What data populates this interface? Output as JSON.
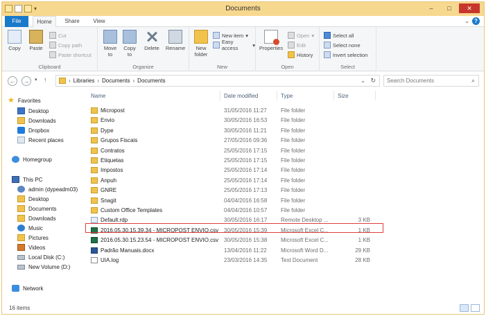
{
  "window": {
    "title": "Documents"
  },
  "ribbon_tabs": [
    "File",
    "Home",
    "Share",
    "View"
  ],
  "ribbon": {
    "clipboard": {
      "copy": "Copy",
      "paste": "Paste",
      "cut": "Cut",
      "copy_path": "Copy path",
      "paste_shortcut": "Paste shortcut",
      "label": "Clipboard"
    },
    "organize": {
      "move_to": "Move to",
      "copy_to": "Copy to",
      "delete": "Delete",
      "rename": "Rename",
      "label": "Organize"
    },
    "new": {
      "new_folder": "New folder",
      "new_item": "New item",
      "easy_access": "Easy access",
      "label": "New"
    },
    "open": {
      "properties": "Properties",
      "open": "Open",
      "edit": "Edit",
      "history": "History",
      "label": "Open"
    },
    "select": {
      "select_all": "Select all",
      "select_none": "Select none",
      "invert_selection": "Invert selection",
      "label": "Select"
    }
  },
  "address": {
    "crumbs": [
      "Libraries",
      "Documents",
      "Documents"
    ],
    "search_placeholder": "Search Documents"
  },
  "nav": {
    "favorites": "Favorites",
    "favorites_items": [
      "Desktop",
      "Downloads",
      "Dropbox",
      "Recent places"
    ],
    "homegroup": "Homegroup",
    "this_pc": "This PC",
    "pc_items": [
      "admin (dypeadm03)",
      "Desktop",
      "Documents",
      "Downloads",
      "Music",
      "Pictures",
      "Videos",
      "Local Disk (C:)",
      "New Volume (D:)"
    ],
    "network": "Network"
  },
  "columns": {
    "name": "Name",
    "date": "Date modified",
    "type": "Type",
    "size": "Size"
  },
  "files": [
    {
      "name": "Micropost",
      "date": "31/05/2016 11:27",
      "type": "File folder",
      "size": "",
      "kind": "folder"
    },
    {
      "name": "Envio",
      "date": "30/05/2016 16:53",
      "type": "File folder",
      "size": "",
      "kind": "folder"
    },
    {
      "name": "Dype",
      "date": "30/05/2016 11:21",
      "type": "File folder",
      "size": "",
      "kind": "folder"
    },
    {
      "name": "Grupos Fiscais",
      "date": "27/05/2016 09:36",
      "type": "File folder",
      "size": "",
      "kind": "folder"
    },
    {
      "name": "Contratos",
      "date": "25/05/2016 17:15",
      "type": "File folder",
      "size": "",
      "kind": "folder"
    },
    {
      "name": "Etiquetas",
      "date": "25/05/2016 17:15",
      "type": "File folder",
      "size": "",
      "kind": "folder"
    },
    {
      "name": "Impostos",
      "date": "25/05/2016 17:14",
      "type": "File folder",
      "size": "",
      "kind": "folder"
    },
    {
      "name": "Anpuh",
      "date": "25/05/2016 17:14",
      "type": "File folder",
      "size": "",
      "kind": "folder"
    },
    {
      "name": "GNRE",
      "date": "25/05/2016 17:13",
      "type": "File folder",
      "size": "",
      "kind": "folder"
    },
    {
      "name": "Snagit",
      "date": "04/04/2016 16:58",
      "type": "File folder",
      "size": "",
      "kind": "folder"
    },
    {
      "name": "Custom Office Templates",
      "date": "04/04/2016 10:57",
      "type": "File folder",
      "size": "",
      "kind": "folder"
    },
    {
      "name": "Default.rdp",
      "date": "30/05/2016 16:17",
      "type": "Remote Desktop ...",
      "size": "3 KB",
      "kind": "rdp"
    },
    {
      "name": "2016.05.30.15.39.34 - MICROPOST ENVIO.csv",
      "date": "30/05/2016 15:39",
      "type": "Microsoft Excel C...",
      "size": "1 KB",
      "kind": "xls"
    },
    {
      "name": "2016.05.30.15.23.54 - MICROPOST ENVIO.csv",
      "date": "30/05/2016 15:38",
      "type": "Microsoft Excel C...",
      "size": "1 KB",
      "kind": "xls"
    },
    {
      "name": "Padrão Manuais.docx",
      "date": "13/04/2016 11:22",
      "type": "Microsoft Word D...",
      "size": "29 KB",
      "kind": "doc"
    },
    {
      "name": "UIA.log",
      "date": "23/03/2016 14:35",
      "type": "Text Document",
      "size": "28 KB",
      "kind": "txt"
    }
  ],
  "status": {
    "count": "16 items"
  }
}
